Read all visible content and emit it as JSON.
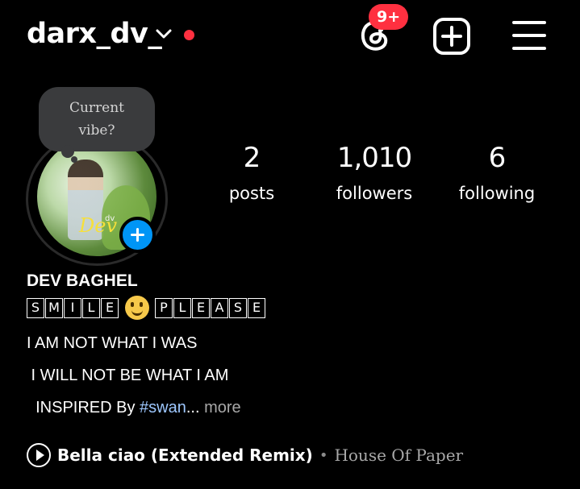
{
  "header": {
    "username": "darx_dv_",
    "notification_badge": "9+",
    "icons": [
      "chevron-down-icon",
      "threads-icon",
      "add-post-icon",
      "hamburger-menu-icon"
    ],
    "live_dot_color": "#ff3040",
    "badge_color": "#ff3040"
  },
  "profile": {
    "note_bubble": [
      "Current",
      "vibe?"
    ],
    "avatar_watermark": "Dev",
    "avatar_watermark_small": "dv",
    "story_add_color": "#0095f6",
    "stats": [
      {
        "value": "2",
        "label": "posts"
      },
      {
        "value": "1,010",
        "label": "followers"
      },
      {
        "value": "6",
        "label": "following"
      }
    ]
  },
  "bio": {
    "full_name": "DEV BAGHEL",
    "tagline_word1": [
      "S",
      "M",
      "I",
      "L",
      "E"
    ],
    "tagline_emoji": "smiling-face-emoji",
    "tagline_word2": [
      "P",
      "L",
      "E",
      "A",
      "S",
      "E"
    ],
    "line1": "I AM NOT WHAT I WAS",
    "line2": " I WILL NOT BE WHAT I AM",
    "line3_prefix": "  INSPIRED By ",
    "line3_hashtag": "#swan",
    "line3_ellipsis": "... ",
    "more_label": "more",
    "hashtag_color": "#9ec8ff"
  },
  "music": {
    "song": "Bella ciao (Extended Remix)",
    "separator": "•",
    "artist": "House Of Paper"
  }
}
